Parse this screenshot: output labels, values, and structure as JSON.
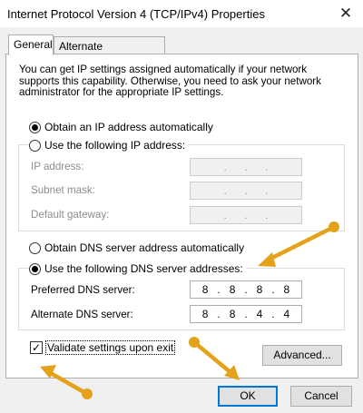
{
  "window": {
    "title": "Internet Protocol Version 4 (TCP/IPv4) Properties",
    "close_glyph": "✕"
  },
  "tabs": [
    {
      "label": "General"
    },
    {
      "label": "Alternate Configuration"
    }
  ],
  "description": "You can get IP settings assigned automatically if your network supports this capability. Otherwise, you need to ask your network administrator for the appropriate IP settings.",
  "ip": {
    "auto_label": "Obtain an IP address automatically",
    "manual_label": "Use the following IP address:",
    "fields": [
      {
        "label": "IP address:",
        "value": ". . ."
      },
      {
        "label": "Subnet mask:",
        "value": ". . ."
      },
      {
        "label": "Default gateway:",
        "value": ". . ."
      }
    ]
  },
  "dns": {
    "auto_label": "Obtain DNS server address automatically",
    "manual_label": "Use the following DNS server addresses:",
    "preferred": {
      "label": "Preferred DNS server:",
      "octets": [
        "8",
        "8",
        "8",
        "8"
      ]
    },
    "alternate": {
      "label": "Alternate DNS server:",
      "octets": [
        "8",
        "8",
        "4",
        "4"
      ]
    }
  },
  "validate": {
    "label": "Validate settings upon exit",
    "checked": true,
    "check_glyph": "✓"
  },
  "buttons": {
    "advanced": "Advanced...",
    "ok": "OK",
    "cancel": "Cancel"
  },
  "colors": {
    "annotation_arrow": "#e3a21a",
    "focus_blue": "#0078d7"
  }
}
